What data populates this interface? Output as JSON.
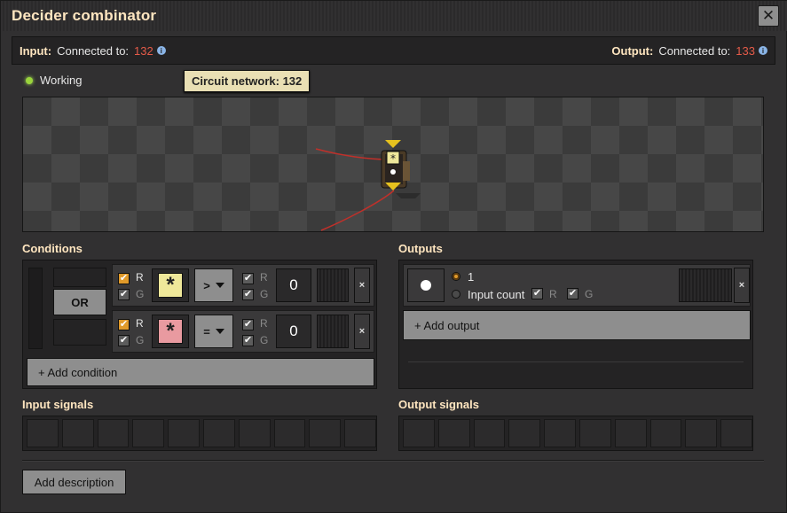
{
  "window": {
    "title": "Decider combinator"
  },
  "connections": {
    "input_label": "Input:",
    "input_text": "Connected to:",
    "input_id": "132",
    "output_label": "Output:",
    "output_text": "Connected to:",
    "output_id": "133"
  },
  "status": {
    "text": "Working",
    "color": "#9ad43c"
  },
  "tooltip": {
    "text": "Circuit network: 132"
  },
  "conditions": {
    "title": "Conditions",
    "or_label": "OR",
    "add_label": "+ Add condition",
    "rows": [
      {
        "left_r": "R",
        "left_g": "G",
        "signal": "*",
        "signal_color": "#efe89a",
        "operator": ">",
        "right_r": "R",
        "right_g": "G",
        "constant": "0"
      },
      {
        "left_r": "R",
        "left_g": "G",
        "signal": "*",
        "signal_color": "#e99aa0",
        "operator": "=",
        "right_r": "R",
        "right_g": "G",
        "constant": "0"
      }
    ]
  },
  "outputs": {
    "title": "Outputs",
    "value_option": "1",
    "input_count_option": "Input count",
    "r_label": "R",
    "g_label": "G",
    "add_label": "+ Add output"
  },
  "input_signals": {
    "title": "Input signals"
  },
  "output_signals": {
    "title": "Output signals"
  },
  "description_button": "Add description"
}
